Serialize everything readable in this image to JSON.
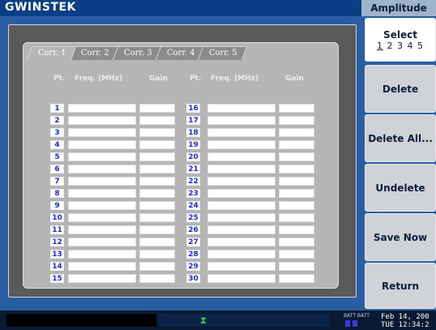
{
  "brand": "GWINSTEK",
  "menu_title": "Amplitude",
  "select": {
    "title": "Select",
    "options": [
      "1",
      "2",
      "3",
      "4",
      "5"
    ],
    "selected": "1"
  },
  "softkeys": [
    "Delete",
    "Delete All...",
    "Undelete",
    "Save Now",
    "Return"
  ],
  "tabs": [
    "Corr. 1",
    "Corr. 2",
    "Corr. 3",
    "Corr. 4",
    "Corr. 5"
  ],
  "active_tab": 0,
  "headers": {
    "pt": "Pt.",
    "freq": "Freq. (MHz)",
    "gain": "Gain"
  },
  "left_points": [
    "1",
    "2",
    "3",
    "4",
    "5",
    "6",
    "7",
    "8",
    "9",
    "10",
    "11",
    "12",
    "13",
    "14",
    "15"
  ],
  "right_points": [
    "16",
    "17",
    "18",
    "19",
    "20",
    "21",
    "22",
    "23",
    "24",
    "25",
    "26",
    "27",
    "28",
    "29",
    "30"
  ],
  "status": {
    "battery_label": "BATT BATT",
    "date_line": "Feb 14, 200",
    "time_line": "TUE 12:34:2"
  }
}
